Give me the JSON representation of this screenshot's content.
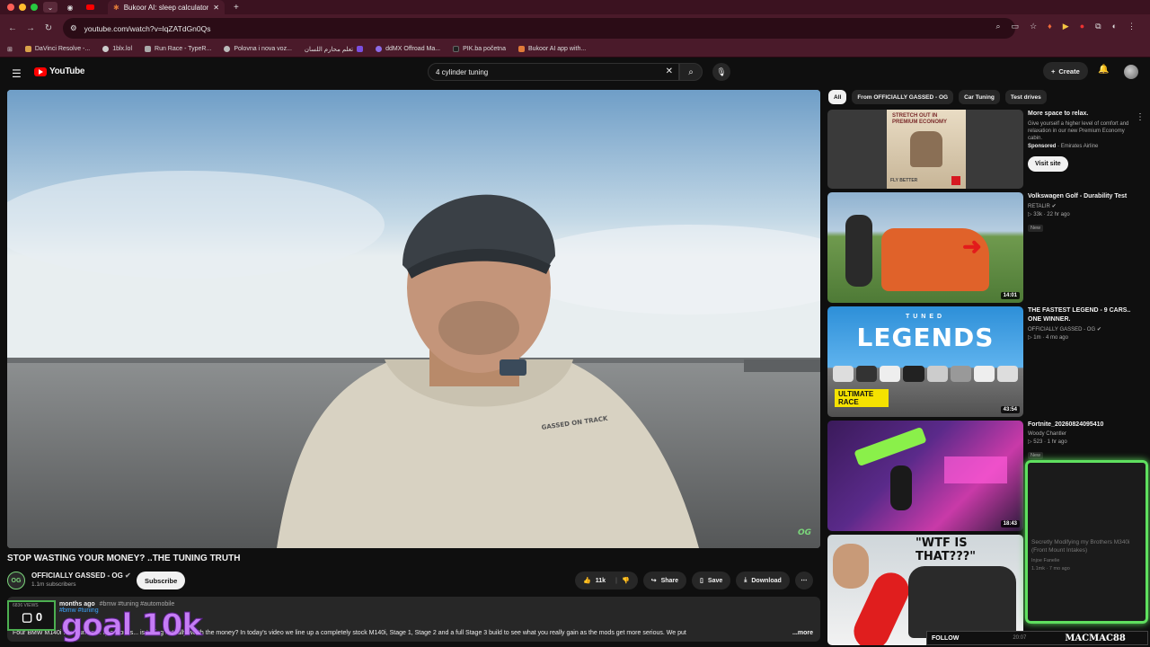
{
  "browser": {
    "tab_title": "Bukoor AI: sleep calculator ap",
    "url": "youtube.com/watch?v=lqZATdGn0Qs",
    "bookmarks": [
      "DaVinci Resolve -...",
      "1blx.lol",
      "Run Race - TypeR...",
      "Polovna i nova voz...",
      "تعلم محارم اللسان",
      "ddMX Offroad Ma...",
      "PIK.ba početna",
      "Bukoor AI app with..."
    ]
  },
  "header": {
    "logo": "YouTube",
    "search_value": "4 cylinder tuning",
    "create_label": "Create"
  },
  "video": {
    "title": "STOP WASTING YOUR MONEY? ..THE TUNING TRUTH",
    "channel": "OFFICIALLY GASSED - OG",
    "subscribers": "1.1m subscribers",
    "subscribe_label": "Subscribe",
    "likes": "11k",
    "share_label": "Share",
    "save_label": "Save",
    "download_label": "Download",
    "watermark": "OG",
    "hoodie_text": "GASSED ON TRACK"
  },
  "description": {
    "meta": "months ago",
    "tags": "#bmw #tuning #automobile",
    "tags2": "#bmw #tuning",
    "text": "Four BMW M140i ... of tuning ... question is... is tuning actually worth the money? In today's video we line up a completely stock M140i, Stage 1, Stage 2 and a full Stage 3 build to see what you really gain as the mods get more serious. We put",
    "more": "...more"
  },
  "overlay": {
    "views_label": "6836 VIEWS",
    "count": "0",
    "goal": "goal 10k",
    "cam_title": "Secretly Modifying my Brothers M340i (Front Mount Intakes)",
    "cam_meta": "Injoe Fanelie",
    "cam_meta2": "1.1mk · 7 mo ago",
    "follow": "FOLLOW",
    "time": "20:07",
    "streamer": "MACMAC88"
  },
  "chips": [
    "All",
    "From OFFICIALLY GASSED - OG",
    "Car Tuning",
    "Test drives"
  ],
  "ad": {
    "title": "More space to relax.",
    "desc": "Give yourself a higher level of comfort and relaxation in our new Premium Economy cabin.",
    "sponsored": "Sponsored",
    "advertiser": "Emirates Airline",
    "cta": "Visit site",
    "thumb_text": "STRETCH OUT IN PREMIUM ECONOMY",
    "thumb_text2": "FLY BETTER"
  },
  "recommendations": [
    {
      "title": "Volkswagen Golf - Durability Test",
      "channel": "RETALIR",
      "meta": "33k · 22 hr ago",
      "badge": "New",
      "duration": "14:01"
    },
    {
      "title": "THE FASTEST LEGEND - 9 CARS.. ONE WINNER.",
      "channel": "OFFICIALLY GASSED - OG",
      "meta": "1m · 4 mo ago",
      "badge": "",
      "duration": "43:54",
      "thumb_text": "LEGENDS",
      "thumb_sub": "TUNED",
      "thumb_tag": "ULTIMATE RACE"
    },
    {
      "title": "Fortnite_20260824095410",
      "channel": "Woody Chantler",
      "meta": "523 · 1 hr ago",
      "badge": "New",
      "duration": "18:43"
    },
    {
      "thumb_text": "\"WTF IS THAT???\""
    }
  ],
  "colors": {
    "accent": "#ff0000",
    "overlay_green": "#5fe05f",
    "goal_purple": "#c57cf5"
  }
}
